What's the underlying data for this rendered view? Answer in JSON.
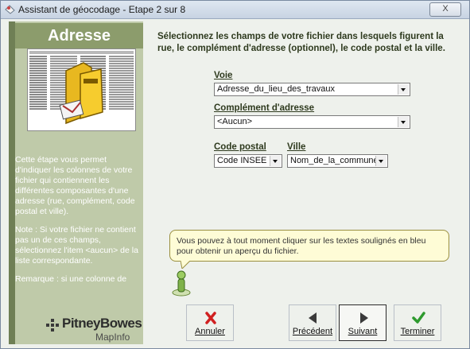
{
  "window": {
    "title": "Assistant de géocodage - Etape 2 sur 8",
    "close_label": "X"
  },
  "left_panel": {
    "title": "Adresse",
    "description": "Cette étape vous permet d'indiquer les colonnes de votre fichier qui contiennent les différentes composantes d'une adresse (rue, complément, code postal et ville).",
    "note": "Note : Si votre fichier ne contient pas un de ces champs, sélectionnez l'item <aucun> de la liste correspondante.",
    "remark": "Remarque : si une colonne de",
    "logo_name": "PitneyBowes",
    "logo_sub": "MapInfo"
  },
  "main": {
    "heading": "Sélectionnez les champs de votre fichier dans lesquels figurent la rue, le complément d'adresse (optionnel), le code postal et la ville.",
    "voie": {
      "label": "Voie",
      "value": "Adresse_du_lieu_des_travaux"
    },
    "complement": {
      "label": "Complément d'adresse",
      "value": "<Aucun>"
    },
    "code_postal": {
      "label": "Code postal",
      "value": "Code INSEE"
    },
    "ville": {
      "label": "Ville",
      "value": "Nom_de_la_commune_lieu"
    },
    "tip": "Vous pouvez à tout moment cliquer sur les textes soulignés en bleu pour obtenir un aperçu du fichier."
  },
  "buttons": {
    "cancel": "Annuler",
    "previous": "Précédent",
    "next": "Suivant",
    "finish": "Terminer"
  },
  "colors": {
    "panel_bg": "#bfcaa9",
    "title_bar": "#8c9c6c",
    "cancel_icon": "#d02020",
    "finish_icon": "#2e9a2e"
  }
}
